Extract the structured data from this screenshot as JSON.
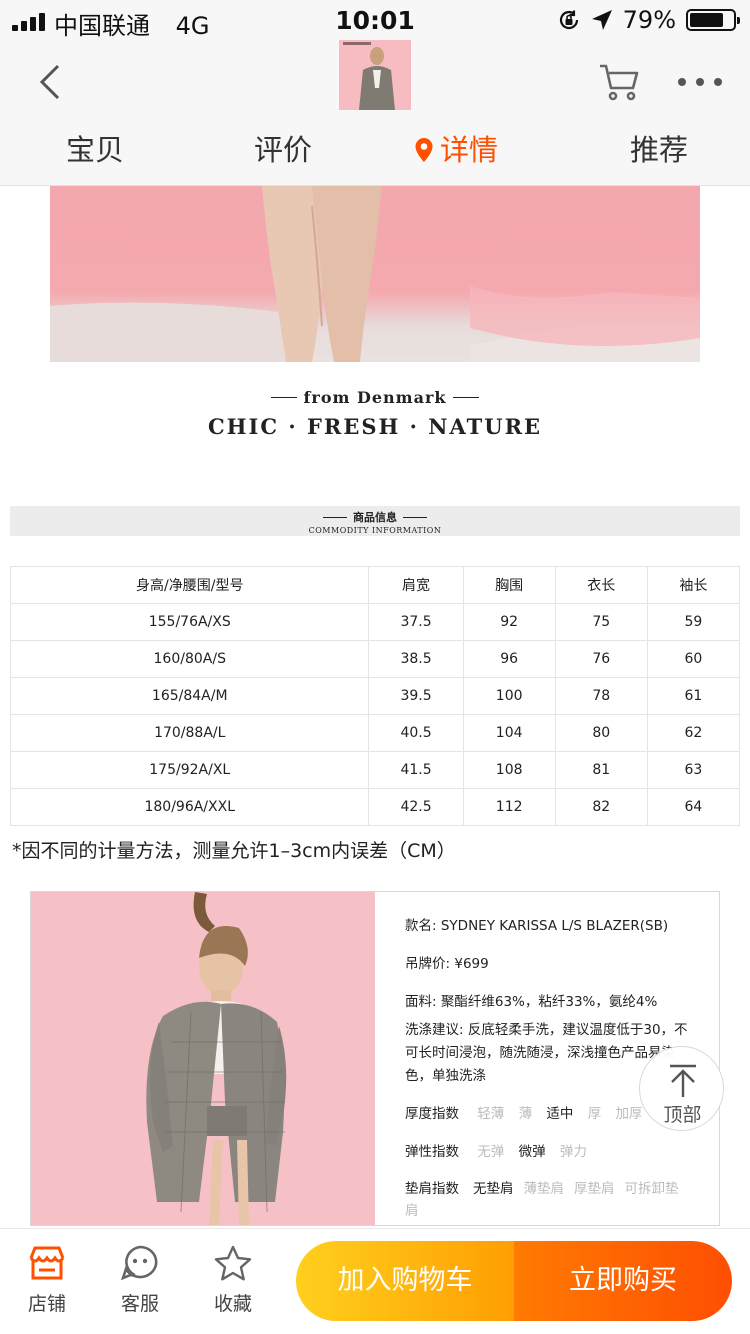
{
  "status": {
    "carrier": "中国联通",
    "network": "4G",
    "time": "10:01",
    "battery": "79%"
  },
  "nav": {
    "tabs": [
      {
        "label": "宝贝",
        "active": false
      },
      {
        "label": "评价",
        "active": false
      },
      {
        "label": "详情",
        "active": true
      },
      {
        "label": "推荐",
        "active": false
      }
    ],
    "accent": "#ff5000"
  },
  "brand": {
    "tagline": "from Denmark",
    "slogan": "CHIC · FRESH · NATURE"
  },
  "section": {
    "title": "商品信息",
    "subtitle": "COMMODITY INFORMATION"
  },
  "size_table": {
    "headers": [
      "身高/净腰围/型号",
      "肩宽",
      "胸围",
      "衣长",
      "袖长"
    ],
    "rows": [
      [
        "155/76A/XS",
        "37.5",
        "92",
        "75",
        "59"
      ],
      [
        "160/80A/S",
        "38.5",
        "96",
        "76",
        "60"
      ],
      [
        "165/84A/M",
        "39.5",
        "100",
        "78",
        "61"
      ],
      [
        "170/88A/L",
        "40.5",
        "104",
        "80",
        "62"
      ],
      [
        "175/92A/XL",
        "41.5",
        "108",
        "81",
        "63"
      ],
      [
        "180/96A/XXL",
        "42.5",
        "112",
        "82",
        "64"
      ]
    ],
    "note": "*因不同的计量方法，测量允许1–3cm内误差（CM）"
  },
  "product": {
    "name_label": "款名:",
    "name": "SYDNEY KARISSA L/S BLAZER(SB)",
    "price_label": "吊牌价:",
    "price": "¥699",
    "fabric_label": "面料:",
    "fabric": "聚酯纤维63%，粘纤33%，氨纶4%",
    "wash_label": "洗涤建议:",
    "wash": "反底轻柔手洗，建议温度低于30，不可长时间浸泡，随洗随浸，深浅撞色产品易染色，单独洗涤",
    "thickness": {
      "label": "厚度指数",
      "options": [
        "轻薄",
        "薄",
        "适中",
        "厚",
        "加厚"
      ],
      "selected": "适中"
    },
    "elasticity": {
      "label": "弹性指数",
      "options": [
        "无弹",
        "微弹",
        "弹力"
      ],
      "selected": "微弹"
    },
    "padding": {
      "label": "垫肩指数",
      "options": [
        "无垫肩",
        "薄垫肩",
        "厚垫肩",
        "可拆卸垫肩"
      ],
      "selected": "无垫肩"
    }
  },
  "back_to_top": "顶部",
  "bottom": {
    "shop": "店铺",
    "service": "客服",
    "favorite": "收藏",
    "add_cart": "加入购物车",
    "buy_now": "立即购买"
  }
}
